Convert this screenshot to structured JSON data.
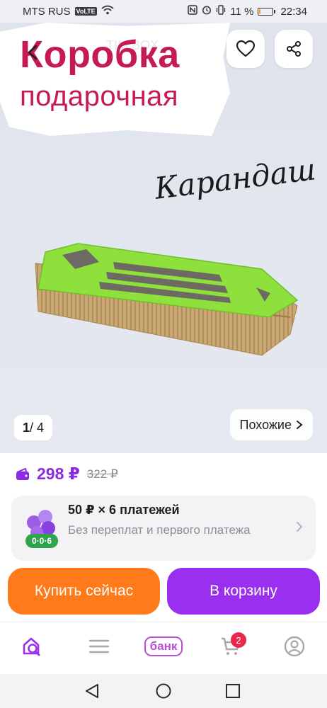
{
  "status_bar": {
    "carrier": "MTS RUS",
    "volte": "VoLTE",
    "battery_percent": "11 %",
    "battery_level": 0.11,
    "time": "22:34"
  },
  "product": {
    "image_title_line1": "Коробка",
    "image_title_line2": "подарочная",
    "image_script": "Карандаш",
    "watermark": "TIM BOX",
    "image_counter_current": "1",
    "image_counter_total": "/ 4",
    "similar_label": "Похожие",
    "price": "298 ₽",
    "old_price": "322 ₽",
    "accent_color": "#8a2be2"
  },
  "installments": {
    "logo_badge": "0·0·6",
    "title": "50 ₽ × 6 платежей",
    "subtitle": "Без переплат и первого платежа"
  },
  "actions": {
    "buy_now": "Купить сейчас",
    "add_to_cart": "В корзину",
    "buy_color": "#ff7a1a",
    "cart_color": "#9b2ff0"
  },
  "bottom_nav": {
    "bank_label": "банк",
    "cart_count": "2",
    "items": [
      "home-search-icon",
      "menu-icon",
      "bank",
      "cart-icon",
      "profile-icon"
    ]
  }
}
